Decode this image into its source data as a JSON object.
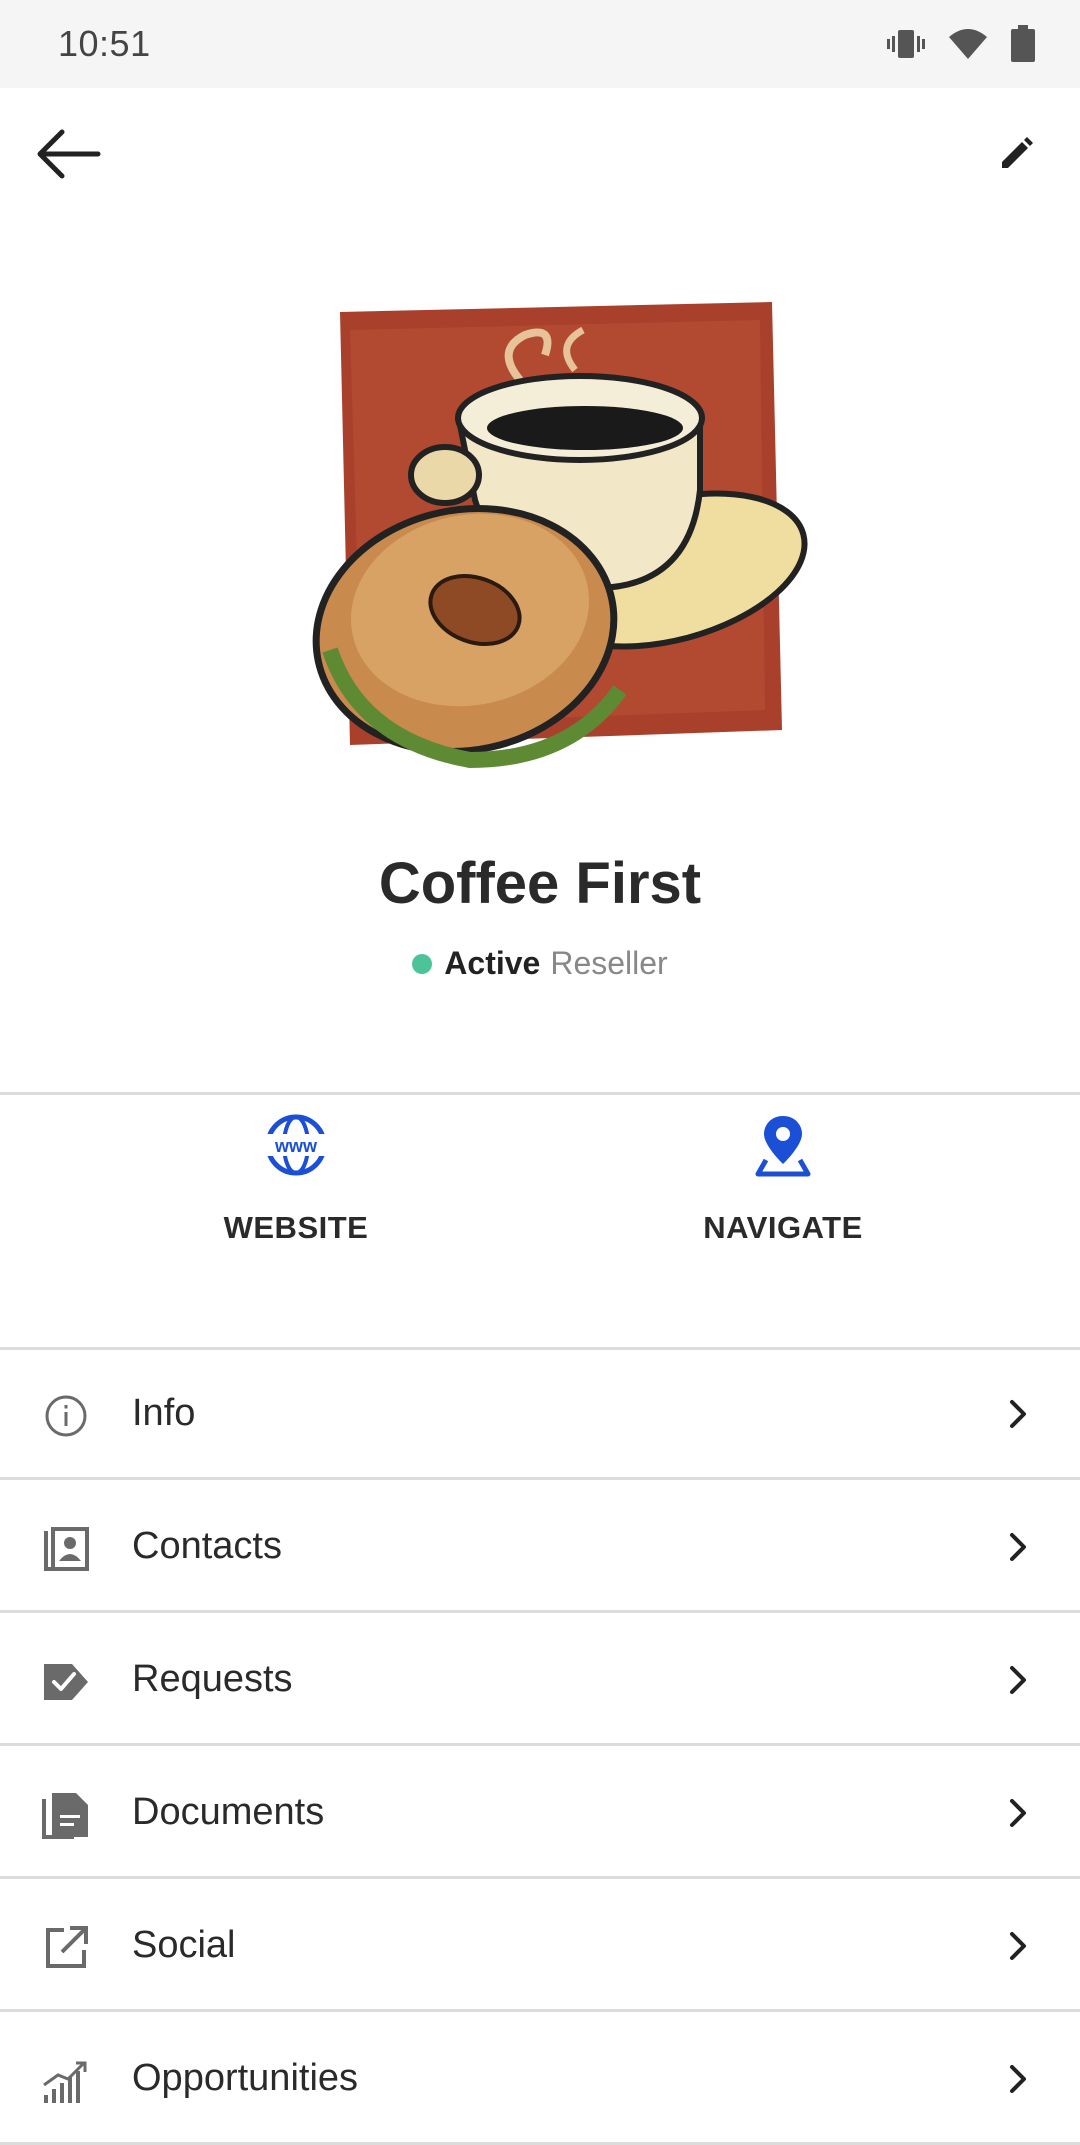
{
  "status_bar": {
    "time": "10:51",
    "icons": [
      "vibrate-icon",
      "wifi-icon",
      "battery-icon"
    ]
  },
  "toolbar": {
    "back_icon": "arrow-left-icon",
    "edit_icon": "pencil-icon"
  },
  "account": {
    "logo": "coffee-and-bagel-logo",
    "name": "Coffee First",
    "status": "Active",
    "type": "Reseller",
    "status_color": "#4cc49a"
  },
  "actions": [
    {
      "label": "WEBSITE",
      "icon": "globe-www-icon"
    },
    {
      "label": "NAVIGATE",
      "icon": "map-pin-icon"
    }
  ],
  "menu": [
    {
      "label": "Info",
      "icon": "info-icon"
    },
    {
      "label": "Contacts",
      "icon": "contacts-icon"
    },
    {
      "label": "Requests",
      "icon": "requests-icon"
    },
    {
      "label": "Documents",
      "icon": "document-icon"
    },
    {
      "label": "Social",
      "icon": "external-link-icon"
    },
    {
      "label": "Opportunities",
      "icon": "bar-chart-icon"
    }
  ],
  "colors": {
    "accent_blue": "#1a4fd6",
    "icon_gray": "#6a6a6a"
  }
}
